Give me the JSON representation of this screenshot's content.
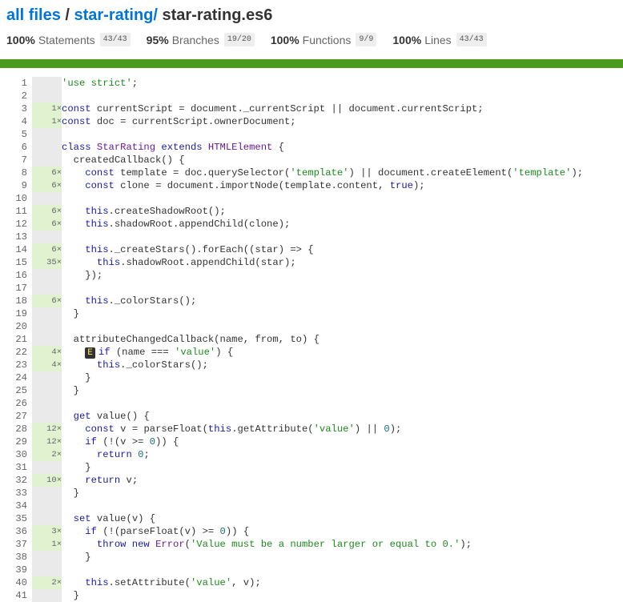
{
  "breadcrumb": {
    "all_files": "all files",
    "sep": " / ",
    "folder": "star-rating/",
    "file": " star-rating.es6"
  },
  "summary": [
    {
      "pct": "100%",
      "label": "Statements",
      "fraction": "43/43"
    },
    {
      "pct": "95%",
      "label": "Branches",
      "fraction": "19/20"
    },
    {
      "pct": "100%",
      "label": "Functions",
      "fraction": "9/9"
    },
    {
      "pct": "100%",
      "label": "Lines",
      "fraction": "43/43"
    }
  ],
  "colors": {
    "status_bar": "#4d9a1e",
    "hit_bg": "#e1f2d1",
    "neutral_bg": "#eaeaea",
    "link": "#0074D9"
  },
  "branch_marker": "E",
  "lines": [
    {
      "n": "1",
      "c": "",
      "t": "'use strict';"
    },
    {
      "n": "2",
      "c": "",
      "t": ""
    },
    {
      "n": "3",
      "c": "1×",
      "t": "const currentScript = document._currentScript || document.currentScript;"
    },
    {
      "n": "4",
      "c": "1×",
      "t": "const doc = currentScript.ownerDocument;"
    },
    {
      "n": "5",
      "c": "",
      "t": ""
    },
    {
      "n": "6",
      "c": "",
      "t": "class StarRating extends HTMLElement {"
    },
    {
      "n": "7",
      "c": "",
      "t": "  createdCallback() {"
    },
    {
      "n": "8",
      "c": "6×",
      "t": "    const template = doc.querySelector('template') || document.createElement('template');"
    },
    {
      "n": "9",
      "c": "6×",
      "t": "    const clone = document.importNode(template.content, true);"
    },
    {
      "n": "10",
      "c": "",
      "t": ""
    },
    {
      "n": "11",
      "c": "6×",
      "t": "    this.createShadowRoot();"
    },
    {
      "n": "12",
      "c": "6×",
      "t": "    this.shadowRoot.appendChild(clone);"
    },
    {
      "n": "13",
      "c": "",
      "t": ""
    },
    {
      "n": "14",
      "c": "6×",
      "t": "    this._createStars().forEach((star) => {"
    },
    {
      "n": "15",
      "c": "35×",
      "t": "      this.shadowRoot.appendChild(star);"
    },
    {
      "n": "16",
      "c": "",
      "t": "    });"
    },
    {
      "n": "17",
      "c": "",
      "t": ""
    },
    {
      "n": "18",
      "c": "6×",
      "t": "    this._colorStars();"
    },
    {
      "n": "19",
      "c": "",
      "t": "  }"
    },
    {
      "n": "20",
      "c": "",
      "t": ""
    },
    {
      "n": "21",
      "c": "",
      "t": "  attributeChangedCallback(name, from, to) {"
    },
    {
      "n": "22",
      "c": "4×",
      "t": "    if (name === 'value') {",
      "badge": true
    },
    {
      "n": "23",
      "c": "4×",
      "t": "      this._colorStars();"
    },
    {
      "n": "24",
      "c": "",
      "t": "    }"
    },
    {
      "n": "25",
      "c": "",
      "t": "  }"
    },
    {
      "n": "26",
      "c": "",
      "t": ""
    },
    {
      "n": "27",
      "c": "",
      "t": "  get value() {"
    },
    {
      "n": "28",
      "c": "12×",
      "t": "    const v = parseFloat(this.getAttribute('value') || 0);"
    },
    {
      "n": "29",
      "c": "12×",
      "t": "    if (!(v >= 0)) {"
    },
    {
      "n": "30",
      "c": "2×",
      "t": "      return 0;"
    },
    {
      "n": "31",
      "c": "",
      "t": "    }"
    },
    {
      "n": "32",
      "c": "10×",
      "t": "    return v;"
    },
    {
      "n": "33",
      "c": "",
      "t": "  }"
    },
    {
      "n": "34",
      "c": "",
      "t": ""
    },
    {
      "n": "35",
      "c": "",
      "t": "  set value(v) {"
    },
    {
      "n": "36",
      "c": "3×",
      "t": "    if (!(parseFloat(v) >= 0)) {"
    },
    {
      "n": "37",
      "c": "1×",
      "t": "      throw new Error('Value must be a number larger or equal to 0.');"
    },
    {
      "n": "38",
      "c": "",
      "t": "    }"
    },
    {
      "n": "39",
      "c": "",
      "t": ""
    },
    {
      "n": "40",
      "c": "2×",
      "t": "    this.setAttribute('value', v);"
    },
    {
      "n": "41",
      "c": "",
      "t": "  }"
    }
  ]
}
